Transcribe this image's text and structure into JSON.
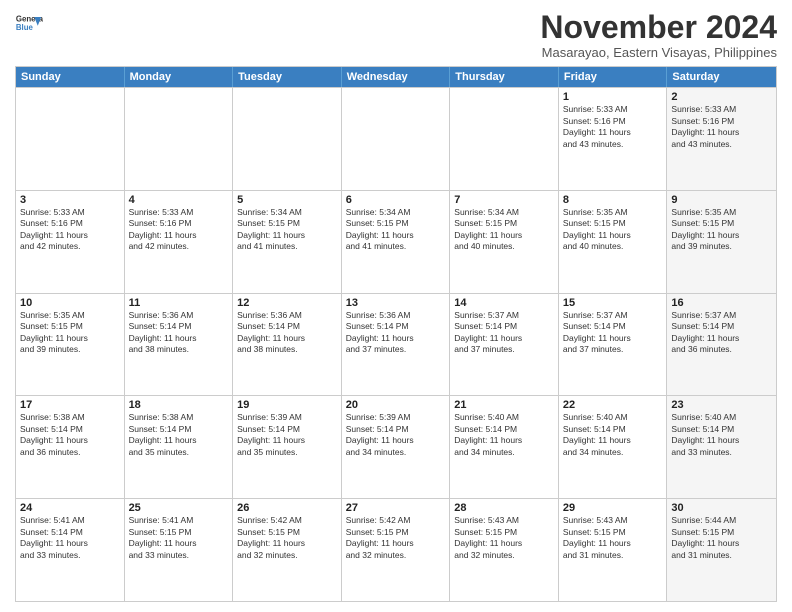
{
  "header": {
    "logo_line1": "General",
    "logo_line2": "Blue",
    "month_title": "November 2024",
    "location": "Masarayao, Eastern Visayas, Philippines"
  },
  "days_of_week": [
    "Sunday",
    "Monday",
    "Tuesday",
    "Wednesday",
    "Thursday",
    "Friday",
    "Saturday"
  ],
  "weeks": [
    [
      {
        "day": "",
        "info": "",
        "shaded": false
      },
      {
        "day": "",
        "info": "",
        "shaded": false
      },
      {
        "day": "",
        "info": "",
        "shaded": false
      },
      {
        "day": "",
        "info": "",
        "shaded": false
      },
      {
        "day": "",
        "info": "",
        "shaded": false
      },
      {
        "day": "1",
        "info": "Sunrise: 5:33 AM\nSunset: 5:16 PM\nDaylight: 11 hours\nand 43 minutes.",
        "shaded": false
      },
      {
        "day": "2",
        "info": "Sunrise: 5:33 AM\nSunset: 5:16 PM\nDaylight: 11 hours\nand 43 minutes.",
        "shaded": true
      }
    ],
    [
      {
        "day": "3",
        "info": "Sunrise: 5:33 AM\nSunset: 5:16 PM\nDaylight: 11 hours\nand 42 minutes.",
        "shaded": false
      },
      {
        "day": "4",
        "info": "Sunrise: 5:33 AM\nSunset: 5:16 PM\nDaylight: 11 hours\nand 42 minutes.",
        "shaded": false
      },
      {
        "day": "5",
        "info": "Sunrise: 5:34 AM\nSunset: 5:15 PM\nDaylight: 11 hours\nand 41 minutes.",
        "shaded": false
      },
      {
        "day": "6",
        "info": "Sunrise: 5:34 AM\nSunset: 5:15 PM\nDaylight: 11 hours\nand 41 minutes.",
        "shaded": false
      },
      {
        "day": "7",
        "info": "Sunrise: 5:34 AM\nSunset: 5:15 PM\nDaylight: 11 hours\nand 40 minutes.",
        "shaded": false
      },
      {
        "day": "8",
        "info": "Sunrise: 5:35 AM\nSunset: 5:15 PM\nDaylight: 11 hours\nand 40 minutes.",
        "shaded": false
      },
      {
        "day": "9",
        "info": "Sunrise: 5:35 AM\nSunset: 5:15 PM\nDaylight: 11 hours\nand 39 minutes.",
        "shaded": true
      }
    ],
    [
      {
        "day": "10",
        "info": "Sunrise: 5:35 AM\nSunset: 5:15 PM\nDaylight: 11 hours\nand 39 minutes.",
        "shaded": false
      },
      {
        "day": "11",
        "info": "Sunrise: 5:36 AM\nSunset: 5:14 PM\nDaylight: 11 hours\nand 38 minutes.",
        "shaded": false
      },
      {
        "day": "12",
        "info": "Sunrise: 5:36 AM\nSunset: 5:14 PM\nDaylight: 11 hours\nand 38 minutes.",
        "shaded": false
      },
      {
        "day": "13",
        "info": "Sunrise: 5:36 AM\nSunset: 5:14 PM\nDaylight: 11 hours\nand 37 minutes.",
        "shaded": false
      },
      {
        "day": "14",
        "info": "Sunrise: 5:37 AM\nSunset: 5:14 PM\nDaylight: 11 hours\nand 37 minutes.",
        "shaded": false
      },
      {
        "day": "15",
        "info": "Sunrise: 5:37 AM\nSunset: 5:14 PM\nDaylight: 11 hours\nand 37 minutes.",
        "shaded": false
      },
      {
        "day": "16",
        "info": "Sunrise: 5:37 AM\nSunset: 5:14 PM\nDaylight: 11 hours\nand 36 minutes.",
        "shaded": true
      }
    ],
    [
      {
        "day": "17",
        "info": "Sunrise: 5:38 AM\nSunset: 5:14 PM\nDaylight: 11 hours\nand 36 minutes.",
        "shaded": false
      },
      {
        "day": "18",
        "info": "Sunrise: 5:38 AM\nSunset: 5:14 PM\nDaylight: 11 hours\nand 35 minutes.",
        "shaded": false
      },
      {
        "day": "19",
        "info": "Sunrise: 5:39 AM\nSunset: 5:14 PM\nDaylight: 11 hours\nand 35 minutes.",
        "shaded": false
      },
      {
        "day": "20",
        "info": "Sunrise: 5:39 AM\nSunset: 5:14 PM\nDaylight: 11 hours\nand 34 minutes.",
        "shaded": false
      },
      {
        "day": "21",
        "info": "Sunrise: 5:40 AM\nSunset: 5:14 PM\nDaylight: 11 hours\nand 34 minutes.",
        "shaded": false
      },
      {
        "day": "22",
        "info": "Sunrise: 5:40 AM\nSunset: 5:14 PM\nDaylight: 11 hours\nand 34 minutes.",
        "shaded": false
      },
      {
        "day": "23",
        "info": "Sunrise: 5:40 AM\nSunset: 5:14 PM\nDaylight: 11 hours\nand 33 minutes.",
        "shaded": true
      }
    ],
    [
      {
        "day": "24",
        "info": "Sunrise: 5:41 AM\nSunset: 5:14 PM\nDaylight: 11 hours\nand 33 minutes.",
        "shaded": false
      },
      {
        "day": "25",
        "info": "Sunrise: 5:41 AM\nSunset: 5:15 PM\nDaylight: 11 hours\nand 33 minutes.",
        "shaded": false
      },
      {
        "day": "26",
        "info": "Sunrise: 5:42 AM\nSunset: 5:15 PM\nDaylight: 11 hours\nand 32 minutes.",
        "shaded": false
      },
      {
        "day": "27",
        "info": "Sunrise: 5:42 AM\nSunset: 5:15 PM\nDaylight: 11 hours\nand 32 minutes.",
        "shaded": false
      },
      {
        "day": "28",
        "info": "Sunrise: 5:43 AM\nSunset: 5:15 PM\nDaylight: 11 hours\nand 32 minutes.",
        "shaded": false
      },
      {
        "day": "29",
        "info": "Sunrise: 5:43 AM\nSunset: 5:15 PM\nDaylight: 11 hours\nand 31 minutes.",
        "shaded": false
      },
      {
        "day": "30",
        "info": "Sunrise: 5:44 AM\nSunset: 5:15 PM\nDaylight: 11 hours\nand 31 minutes.",
        "shaded": true
      }
    ]
  ]
}
